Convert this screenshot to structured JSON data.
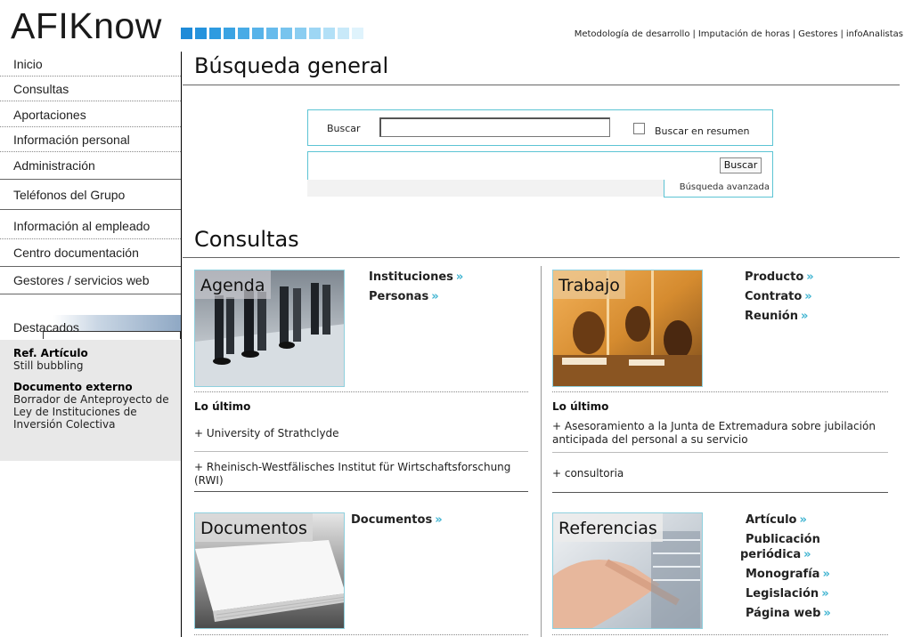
{
  "header": {
    "logo": "AFIKnow",
    "top_links": [
      "Metodología de desarrollo",
      "Imputación de horas",
      "Gestores",
      "infoAnalistas"
    ],
    "separator": "|"
  },
  "sidebar": {
    "items": [
      {
        "label": "Inicio"
      },
      {
        "label": "Consultas"
      },
      {
        "label": "Aportaciones"
      },
      {
        "label": "Información personal"
      },
      {
        "label": "Administración"
      },
      {
        "label": "Teléfonos del Grupo"
      },
      {
        "label": "Información al empleado"
      },
      {
        "label": "Centro documentación"
      },
      {
        "label": "Gestores / servicios web"
      }
    ],
    "destacados": {
      "title": "Destacados",
      "entries": [
        {
          "type": "Ref. Artículo",
          "text": "Still bubbling"
        },
        {
          "type": "Documento externo",
          "text": "Borrador de Anteproyecto de Ley de Instituciones de Inversión Colectiva"
        }
      ]
    }
  },
  "search": {
    "title": "Búsqueda general",
    "label": "Buscar",
    "input_value": "",
    "checkbox_label": "Buscar en resumen",
    "checkbox_checked": false,
    "button_label": "Buscar",
    "advanced_link": "Búsqueda avanzada"
  },
  "consultas": {
    "title": "Consultas",
    "agenda": {
      "label": "Agenda",
      "links": [
        "Instituciones",
        "Personas"
      ],
      "latest_title": "Lo último",
      "latest": [
        "+ University of Strathclyde",
        "+ Rheinisch-Westfälisches Institut für Wirtschaftsforschung (RWI)"
      ]
    },
    "trabajo": {
      "label": "Trabajo",
      "links": [
        "Producto",
        "Contrato",
        "Reunión"
      ],
      "latest_title": "Lo último",
      "latest": [
        "+ Asesoramiento a la Junta de Extremadura sobre jubilación anticipada del personal a su servicio",
        "+ consultoria"
      ]
    },
    "documentos": {
      "label": "Documentos",
      "links": [
        "Documentos"
      ]
    },
    "referencias": {
      "label": "Referencias",
      "links": [
        "Artículo",
        "Publicación periódica",
        "Monografía",
        "Legislación",
        "Página web"
      ]
    },
    "arrow": "»"
  },
  "colors": {
    "accent": "#3fb4d1",
    "box_border": "#5cc4d4",
    "logo_squares": [
      "#1f8bd8",
      "#2593dd",
      "#2e9be0",
      "#3aa3e3",
      "#48abe6",
      "#57b3e9",
      "#67bbec",
      "#78c4ee",
      "#8acdf1",
      "#9dd6f4",
      "#b2e0f7",
      "#c8e9f9",
      "#dff3fc"
    ]
  }
}
